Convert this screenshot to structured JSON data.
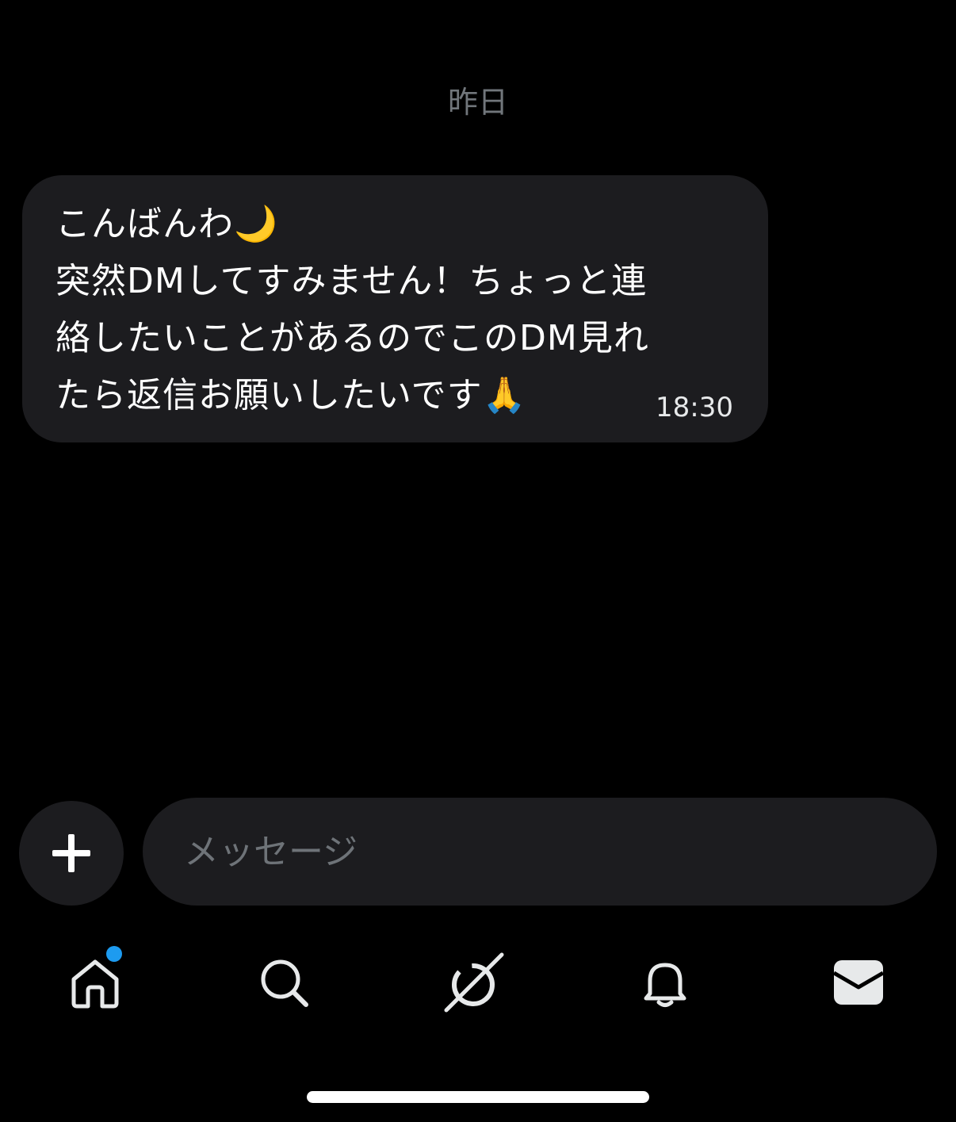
{
  "conversation": {
    "date_separator": "昨日",
    "messages": [
      {
        "text": "こんばんわ🌙\n突然DMしてすみません！ちょっと連絡したいことがあるのでこのDM見れたら返信お願いしたいです🙏",
        "time": "18:30"
      }
    ]
  },
  "composer": {
    "placeholder": "メッセージ",
    "add_icon": "plus-icon"
  },
  "tabbar": {
    "items": [
      {
        "icon": "home-icon",
        "has_notification": true
      },
      {
        "icon": "search-icon"
      },
      {
        "icon": "grok-icon"
      },
      {
        "icon": "bell-icon"
      },
      {
        "icon": "mail-icon"
      }
    ]
  },
  "colors": {
    "background": "#000000",
    "bubble": "#1c1c1f",
    "secondary_text": "#71767b",
    "notification_dot": "#1d9bf0"
  }
}
